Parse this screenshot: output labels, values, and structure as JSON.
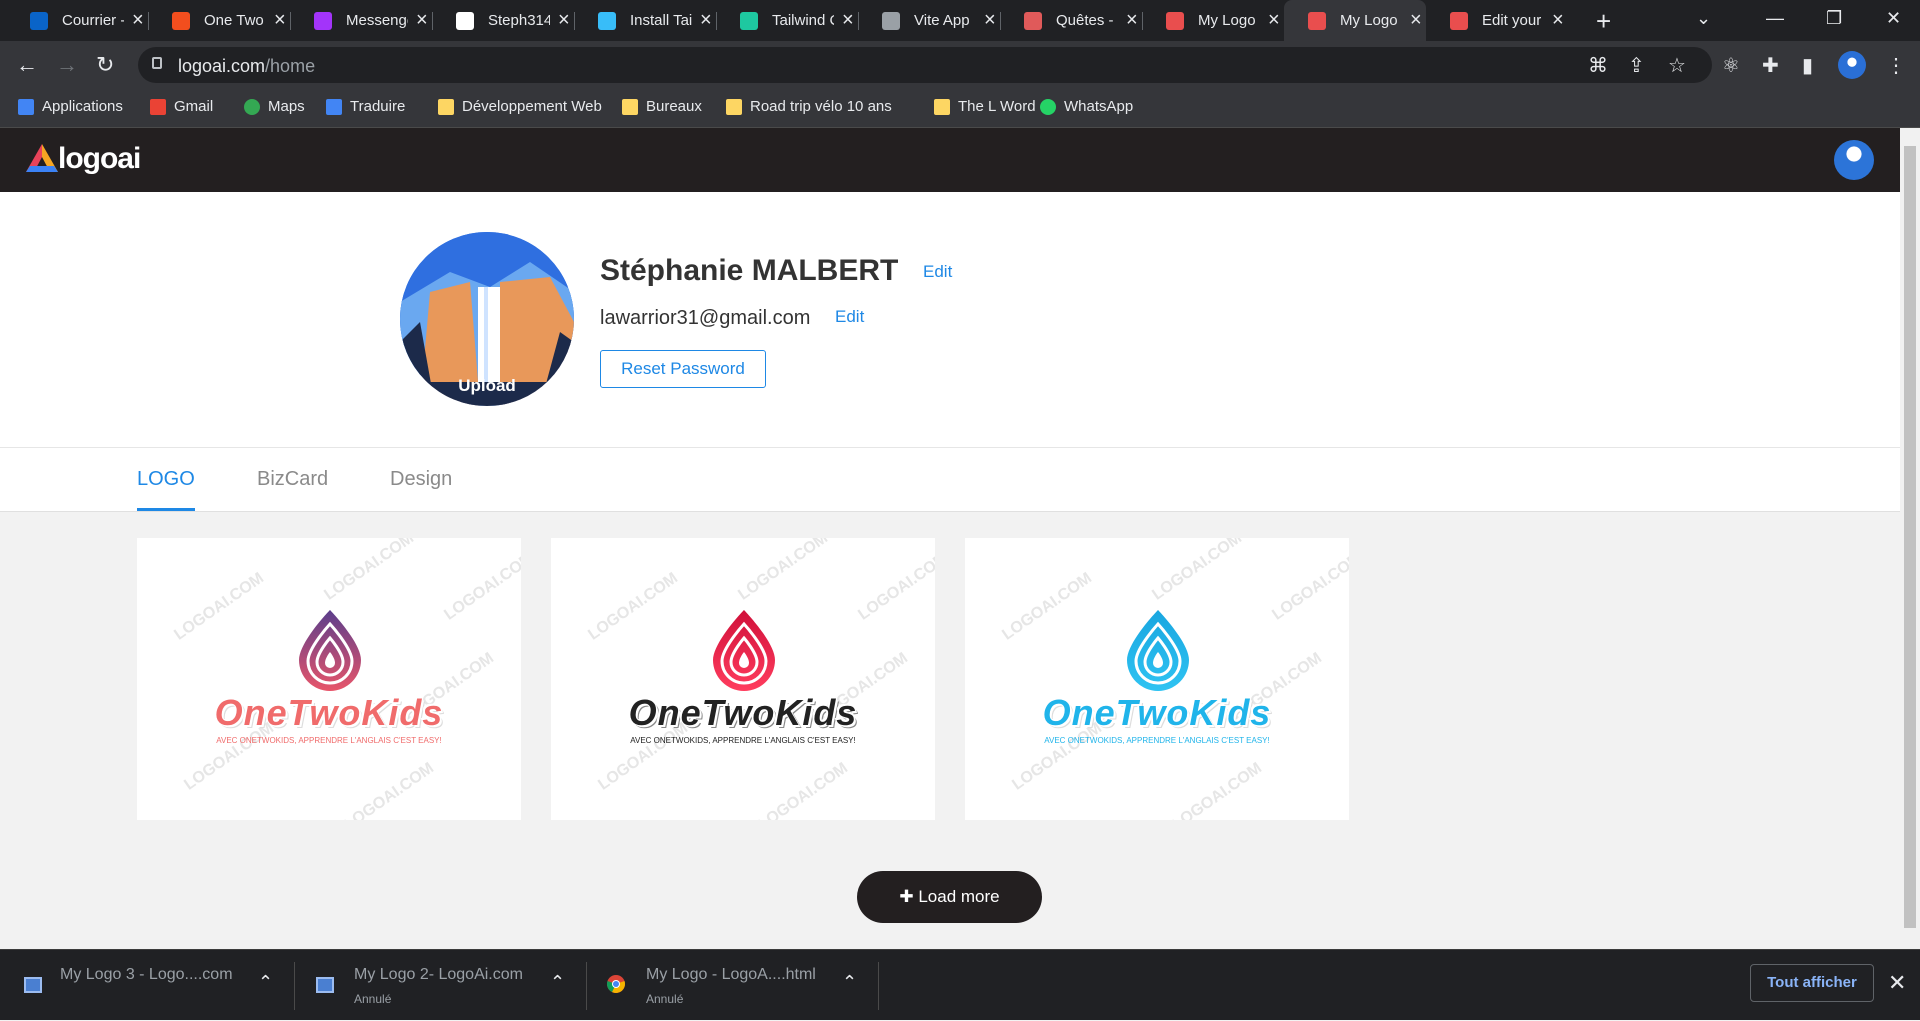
{
  "browser": {
    "tabs": [
      {
        "label": "Courrier -",
        "icon": "outlook-icon",
        "color": "#0a64c8"
      },
      {
        "label": "One Two",
        "icon": "figma-icon",
        "color": "#f24e1e"
      },
      {
        "label": "Messenge",
        "icon": "messenger-icon",
        "color": "#a334fa"
      },
      {
        "label": "Steph314",
        "icon": "github-icon",
        "color": "#ffffff"
      },
      {
        "label": "Install Tai",
        "icon": "tailwind-icon",
        "color": "#38bdf8"
      },
      {
        "label": "Tailwind C",
        "icon": "leaf-icon",
        "color": "#1ec8a0"
      },
      {
        "label": "Vite App",
        "icon": "globe-icon",
        "color": "#9aa0a6"
      },
      {
        "label": "Quêtes -",
        "icon": "quest-icon",
        "color": "#e05a5a"
      },
      {
        "label": "My Logo",
        "icon": "logoai-icon",
        "color": "#e94e4e"
      },
      {
        "label": "My Logo",
        "icon": "logoai-icon",
        "color": "#e94e4e"
      },
      {
        "label": "Edit your",
        "icon": "logoai-icon",
        "color": "#e94e4e"
      }
    ],
    "active_tab": 9,
    "url_domain": "logoai.com",
    "url_path": "/home",
    "bookmarks": [
      {
        "label": "Applications",
        "icon": "apps-grid-icon"
      },
      {
        "label": "Gmail",
        "icon": "gmail-icon"
      },
      {
        "label": "Maps",
        "icon": "maps-icon"
      },
      {
        "label": "Traduire",
        "icon": "translate-icon"
      },
      {
        "label": "Développement Web",
        "icon": "folder-icon"
      },
      {
        "label": "Bureaux",
        "icon": "folder-icon"
      },
      {
        "label": "Road trip vélo 10 ans",
        "icon": "folder-icon"
      },
      {
        "label": "The L Word",
        "icon": "folder-icon"
      },
      {
        "label": "WhatsApp",
        "icon": "whatsapp-icon"
      }
    ]
  },
  "site": {
    "logo_text": "logoai"
  },
  "profile": {
    "name": "Stéphanie MALBERT",
    "email": "lawarrior31@gmail.com",
    "edit_label": "Edit",
    "upload_label": "Upload",
    "reset_password_label": "Reset Password"
  },
  "tabs": {
    "items": [
      "LOGO",
      "BizCard",
      "Design"
    ],
    "active": 0
  },
  "logos": [
    {
      "brand": "OneTwoKids",
      "tagline": "AVEC ONETWOKIDS, APPRENDRE L'ANGLAIS C'EST EASY!",
      "drop_color": "#5b3e8c",
      "drop_color2": "#e8556a",
      "text_color": "#f06b6b"
    },
    {
      "brand": "OneTwoKids",
      "tagline": "AVEC ONETWOKIDS, APPRENDRE L'ANGLAIS C'EST EASY!",
      "drop_color": "#d0103a",
      "drop_color2": "#ff3d5e",
      "text_color": "#222222"
    },
    {
      "brand": "OneTwoKids",
      "tagline": "AVEC ONETWOKIDS, APPRENDRE L'ANGLAIS C'EST EASY!",
      "drop_color": "#19a6e0",
      "drop_color2": "#2fc3f2",
      "text_color": "#20b4ea"
    }
  ],
  "watermark": "LOGOAI.COM",
  "load_more_label": "Load more",
  "downloads": {
    "items": [
      {
        "name": "My Logo 3 - Logo....com",
        "status": ""
      },
      {
        "name": "My Logo 2- LogoAi.com",
        "status": "Annulé"
      },
      {
        "name": "My Logo - LogoA....html",
        "status": "Annulé"
      }
    ],
    "show_all_label": "Tout afficher"
  }
}
